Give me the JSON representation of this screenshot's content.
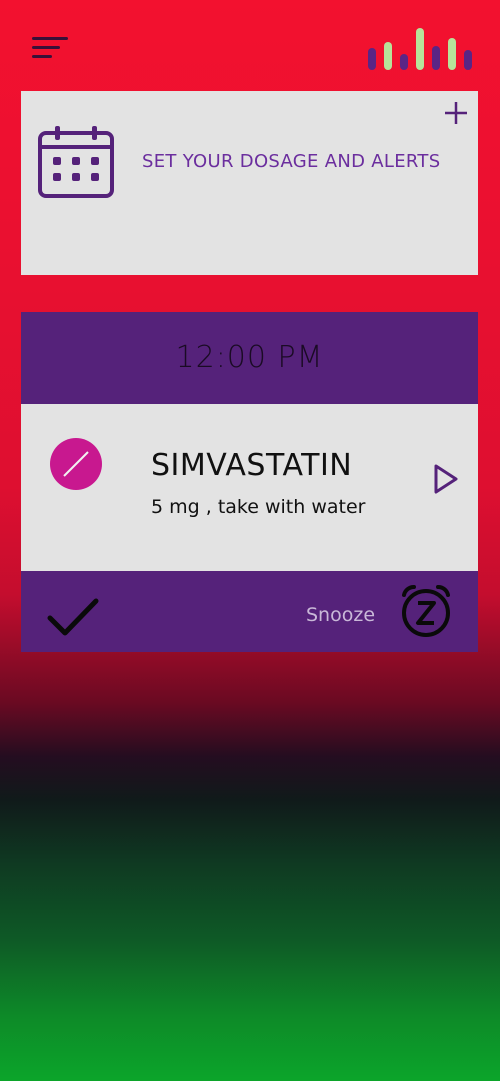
{
  "header": {
    "menu_icon": "hamburger-menu-icon",
    "stats_icon": "bar-stats-icon"
  },
  "dosage_card": {
    "label": "SET YOUR DOSAGE AND ALERTS",
    "calendar_icon": "calendar-icon",
    "add_icon": "plus-icon"
  },
  "schedule": {
    "time": "12:00 PM",
    "medication": {
      "name": "SIMVASTATIN",
      "details": "5 mg , take with water",
      "icon": "pill-icon",
      "open_icon": "play-arrow-icon"
    },
    "actions": {
      "confirm_icon": "checkmark-icon",
      "snooze_label": "Snooze",
      "snooze_icon": "alarm-clock-z-icon"
    }
  },
  "colors": {
    "accent_purple": "#55227a",
    "pill_magenta": "#c8188f",
    "card_gray": "#e3e3e3"
  }
}
